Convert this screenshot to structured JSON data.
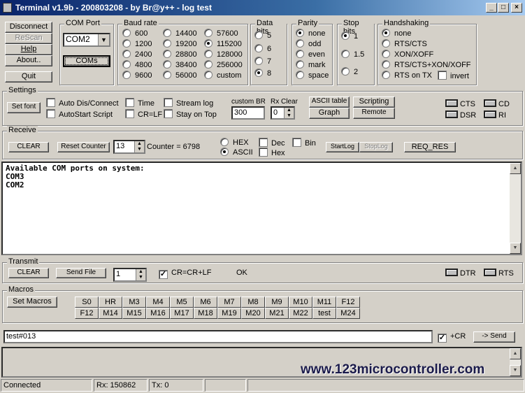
{
  "window": {
    "title": "Terminal v1.9b - 200803208 - by Br@y++ - log test",
    "minimize": "_",
    "maximize": "□",
    "close": "×"
  },
  "left_buttons": {
    "disconnect": "Disconnect",
    "rescan": "ReScan",
    "help": "Help",
    "about": "About..",
    "quit": "Quit"
  },
  "com_port": {
    "label": "COM Port",
    "selected": "COM2",
    "coms_button": "COMs"
  },
  "baud_rate": {
    "label": "Baud rate",
    "options": [
      "600",
      "1200",
      "2400",
      "4800",
      "9600",
      "14400",
      "19200",
      "28800",
      "38400",
      "56000",
      "57600",
      "115200",
      "128000",
      "256000",
      "custom"
    ],
    "selected": "115200"
  },
  "data_bits": {
    "label": "Data bits",
    "options": [
      "5",
      "6",
      "7",
      "8"
    ],
    "selected": "8"
  },
  "parity": {
    "label": "Parity",
    "options": [
      "none",
      "odd",
      "even",
      "mark",
      "space"
    ],
    "selected": "none"
  },
  "stop_bits": {
    "label": "Stop bits",
    "options": [
      "1",
      "1.5",
      "2"
    ],
    "selected": "1"
  },
  "handshaking": {
    "label": "Handshaking",
    "options": [
      "none",
      "RTS/CTS",
      "XON/XOFF",
      "RTS/CTS+XON/XOFF",
      "RTS on TX"
    ],
    "selected": "none",
    "invert_label": "invert",
    "invert": false
  },
  "settings": {
    "label": "Settings",
    "set_font": "Set font",
    "auto_dis_connect": "Auto Dis/Connect",
    "autostart_script": "AutoStart Script",
    "time": "Time",
    "cr_lf": "CR=LF",
    "stream_log": "Stream log",
    "stay_on_top": "Stay on Top",
    "custom_br_label": "custom BR",
    "custom_br": "300",
    "rx_clear_label": "Rx Clear",
    "rx_clear": "0",
    "ascii_table": "ASCII table",
    "graph": "Graph",
    "scripting": "Scripting",
    "remote": "Remote",
    "leds": {
      "cts": "CTS",
      "cd": "CD",
      "dsr": "DSR",
      "ri": "RI"
    }
  },
  "receive": {
    "label": "Receive",
    "clear": "CLEAR",
    "reset_counter": "Reset Counter",
    "counter_spin": "13",
    "counter_text": "Counter =  6798",
    "hex": "HEX",
    "ascii": "ASCII",
    "mode": "ASCII",
    "dec": "Dec",
    "hex_cb": "Hex",
    "bin": "Bin",
    "start_log": "StartLog",
    "stop_log": "StopLog",
    "req_res": "REQ_RES",
    "lines": [
      "Available COM ports on system:",
      "COM3",
      "COM2"
    ]
  },
  "transmit": {
    "label": "Transmit",
    "clear": "CLEAR",
    "send_file": "Send File",
    "spin": "1",
    "cr_crlf": "CR=CR+LF",
    "cr_crlf_checked": true,
    "status": "OK",
    "leds": {
      "dtr": "DTR",
      "rts": "RTS"
    }
  },
  "macros": {
    "label": "Macros",
    "set_macros": "Set Macros",
    "row1": [
      "S0",
      "HR",
      "M3",
      "M4",
      "M5",
      "M6",
      "M7",
      "M8",
      "M9",
      "M10",
      "M11",
      "F12"
    ],
    "row2": [
      "F12",
      "M14",
      "M15",
      "M16",
      "M17",
      "M18",
      "M19",
      "M20",
      "M21",
      "M22",
      "test",
      "M24"
    ]
  },
  "send": {
    "input": "test#013",
    "plus_cr": "+CR",
    "plus_cr_checked": true,
    "send_button": "-> Send"
  },
  "watermark": "www.123microcontroller.com",
  "statusbar": {
    "state": "Connected",
    "rx": "Rx: 150862",
    "tx": "Tx: 0"
  },
  "colors": {
    "titlebar": "#0a246a",
    "face": "#d4d0c8",
    "watermark": "#1a1a4a"
  }
}
